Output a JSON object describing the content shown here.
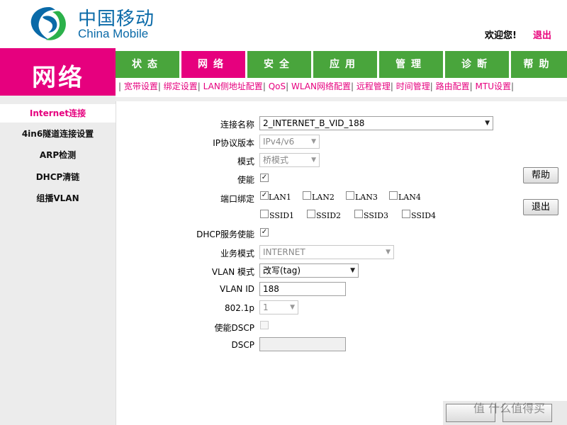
{
  "header": {
    "logo_cn": "中国移动",
    "logo_en": "China Mobile",
    "welcome": "欢迎您!",
    "logout": "退出"
  },
  "section_title": "网络",
  "tabs": [
    {
      "label": "状态"
    },
    {
      "label": "网络"
    },
    {
      "label": "安全"
    },
    {
      "label": "应用"
    },
    {
      "label": "管理"
    },
    {
      "label": "诊断"
    },
    {
      "label": "帮助"
    }
  ],
  "subnav": [
    "宽带设置",
    "绑定设置",
    "LAN侧地址配置",
    "QoS",
    "WLAN网络配置",
    "远程管理",
    "时间管理",
    "路由配置",
    "MTU设置"
  ],
  "sidebar": [
    {
      "label": "Internet连接"
    },
    {
      "label": "4in6隧道连接设置"
    },
    {
      "label": "ARP检测"
    },
    {
      "label": "DHCP清链"
    },
    {
      "label": "组播VLAN"
    }
  ],
  "form": {
    "conn_name_label": "连接名称",
    "conn_name_value": "2_INTERNET_B_VID_188",
    "ip_ver_label": "IP协议版本",
    "ip_ver_value": "IPv4/v6",
    "mode_label": "模式",
    "mode_value": "桥模式",
    "enable_label": "使能",
    "port_label": "端口绑定",
    "ports": [
      "LAN1",
      "LAN2",
      "LAN3",
      "LAN4"
    ],
    "ssids": [
      "SSID1",
      "SSID2",
      "SSID3",
      "SSID4"
    ],
    "dhcp_label": "DHCP服务使能",
    "service_label": "业务模式",
    "service_value": "INTERNET",
    "vlan_mode_label": "VLAN 模式",
    "vlan_mode_value": "改写(tag)",
    "vlan_id_label": "VLAN ID",
    "vlan_id_value": "188",
    "p8021_label": "802.1p",
    "p8021_value": "1",
    "dscp_enable_label": "使能DSCP",
    "dscp_label": "DSCP",
    "dscp_value": ""
  },
  "buttons": {
    "help": "帮助",
    "exit": "退出"
  },
  "watermark": "值 什么值得买",
  "colors": {
    "brand_magenta": "#e6007e",
    "tab_green": "#49a53c",
    "logo_blue": "#0a6aa8"
  }
}
